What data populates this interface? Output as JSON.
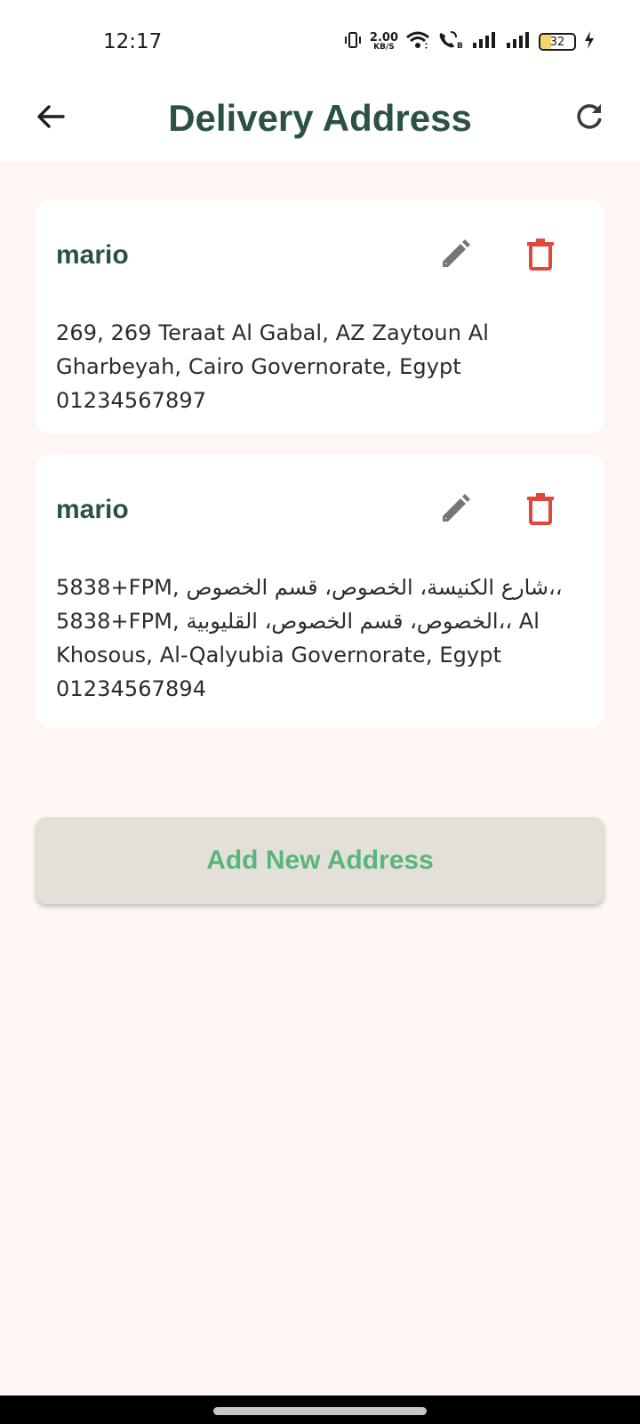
{
  "status_bar": {
    "time": "12:17",
    "net_speed_value": "2.00",
    "net_speed_unit": "KB/S",
    "battery_level": "32",
    "battery_fraction": 0.32,
    "icons": [
      "vibrate-icon",
      "wifi-icon",
      "wifi-calling-icon",
      "signal-icon",
      "signal-icon",
      "battery-icon",
      "charging-icon"
    ]
  },
  "app_bar": {
    "title": "Delivery Address",
    "back_icon": "arrow-back-icon",
    "refresh_icon": "refresh-icon"
  },
  "addresses": [
    {
      "name": "mario",
      "address_lines": [
        "269, 269 Teraat Al Gabal, AZ Zaytoun Al",
        "Gharbeyah, Cairo Governorate, Egypt",
        "01234567897"
      ],
      "edit_icon": "pencil-icon",
      "delete_icon": "trash-icon"
    },
    {
      "name": "mario",
      "address_lines": [
        "5838+FPM, شارع الكنيسة، الخصوص، قسم الخصوص،،",
        "5838+FPM, الخصوص، قسم الخصوص، القليوبية،، Al",
        "Khosous, Al-Qalyubia Governorate, Egypt",
        "01234567894"
      ],
      "edit_icon": "pencil-icon",
      "delete_icon": "trash-icon"
    }
  ],
  "add_button": {
    "label": "Add New Address"
  },
  "colors": {
    "title": "#2a5048",
    "background": "#fdf6f3",
    "delete": "#e0473d",
    "edit": "#757575",
    "add_label": "#5bb57a",
    "add_bg": "#e3e0d9"
  }
}
